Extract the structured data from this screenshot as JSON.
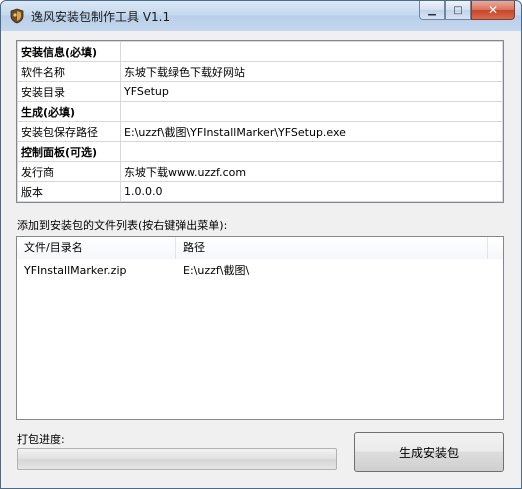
{
  "window": {
    "title": "逸风安装包制作工具 V1.1",
    "icon": "app-shield-icon",
    "minimize_glyph": "▁",
    "maximize_glyph": "□",
    "close_glyph": "✕"
  },
  "info_table": {
    "rows": [
      {
        "key": "安装信息(必填)",
        "value": "",
        "section": true
      },
      {
        "key": "软件名称",
        "value": "东坡下载绿色下载好网站"
      },
      {
        "key": "安装目录",
        "value": "YFSetup"
      },
      {
        "key": "生成(必填)",
        "value": "",
        "section": true
      },
      {
        "key": "安装包保存路径",
        "value": "E:\\uzzf\\截图\\YFInstallMarker\\YFSetup.exe"
      },
      {
        "key": "控制面板(可选)",
        "value": "",
        "section": true
      },
      {
        "key": "发行商",
        "value": "东坡下载www.uzzf.com"
      },
      {
        "key": "版本",
        "value": "1.0.0.0"
      }
    ]
  },
  "file_list": {
    "label": "添加到安装包的文件列表(按右键弹出菜单):",
    "columns": [
      "文件/目录名",
      "路径"
    ],
    "rows": [
      {
        "name": "YFInstallMarker.zip",
        "path": "E:\\uzzf\\截图\\"
      }
    ]
  },
  "progress": {
    "label": "打包进度:",
    "value": 0
  },
  "build_button": {
    "label": "生成安装包"
  }
}
